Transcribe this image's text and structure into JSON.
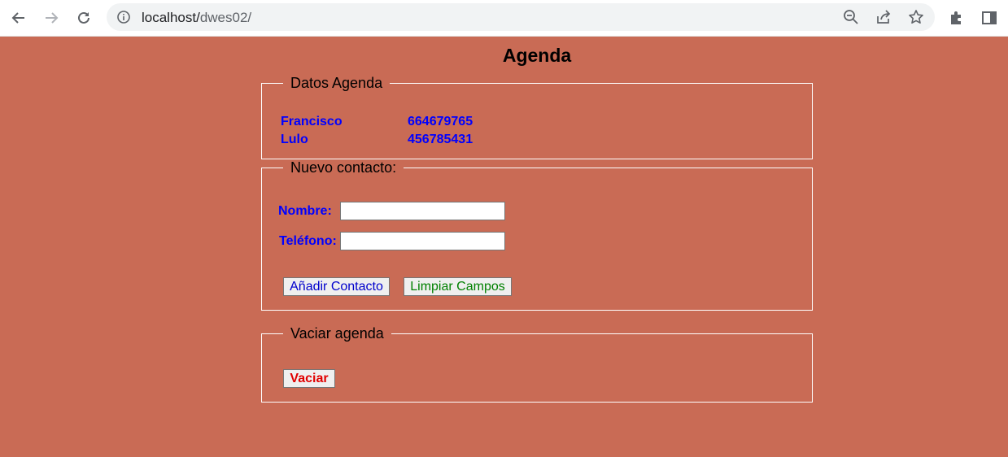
{
  "browser": {
    "url_host": "localhost/",
    "url_path": "dwes02/"
  },
  "page": {
    "title": "Agenda"
  },
  "datos_agenda": {
    "legend": "Datos Agenda",
    "contacts": [
      {
        "name": "Francisco",
        "phone": "664679765"
      },
      {
        "name": "Lulo",
        "phone": "456785431"
      }
    ]
  },
  "nuevo_contacto": {
    "legend": "Nuevo contacto:",
    "nombre_label": "Nombre:",
    "nombre_value": "",
    "telefono_label": "Teléfono:",
    "telefono_value": "",
    "add_button": "Añadir Contacto",
    "clear_button": "Limpiar Campos"
  },
  "vaciar_agenda": {
    "legend": "Vaciar agenda",
    "button": "Vaciar"
  },
  "colors": {
    "page_background": "#c96b55",
    "contact_text": "#0000ff",
    "add_button_text": "#0000cc",
    "clear_button_text": "#008000",
    "vaciar_button_text": "#e00000"
  },
  "icons": [
    "back-arrow-icon",
    "forward-arrow-icon",
    "reload-icon",
    "info-icon",
    "zoom-out-icon",
    "share-icon",
    "bookmark-star-icon",
    "extensions-puzzle-icon",
    "side-panel-icon"
  ]
}
